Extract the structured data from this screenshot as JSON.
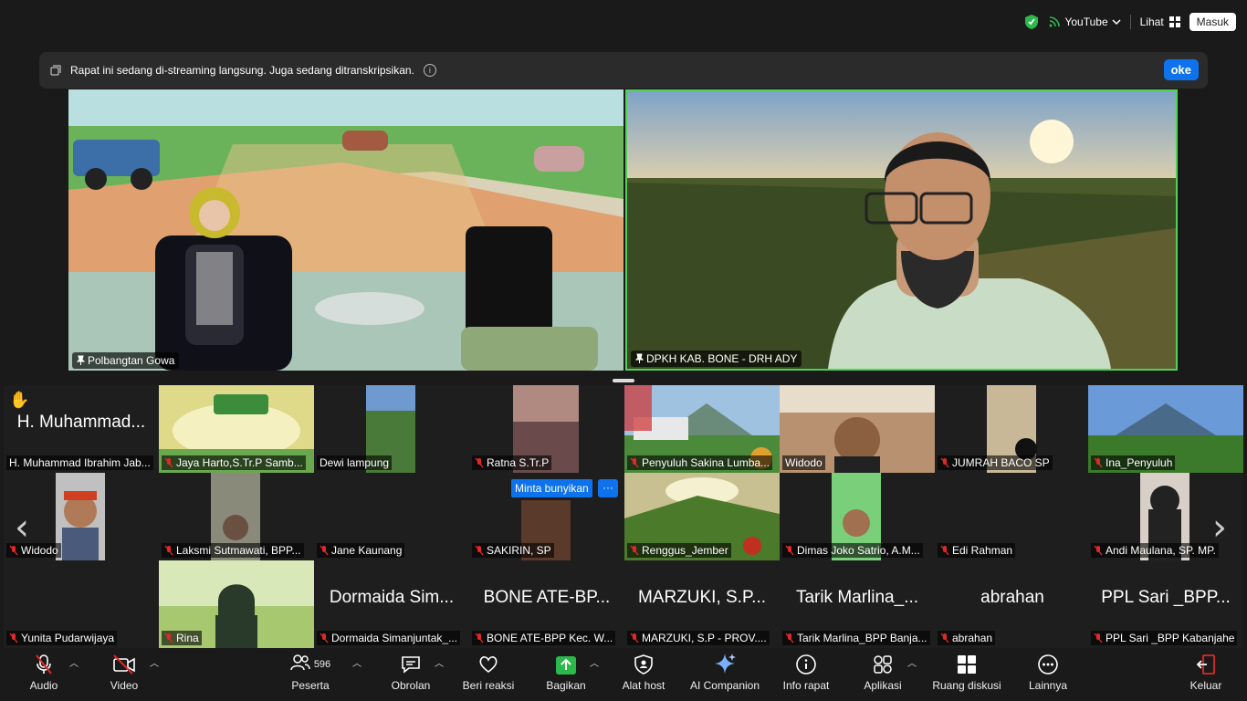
{
  "topbar": {
    "youtube": "YouTube",
    "lihat": "Lihat",
    "masuk": "Masuk"
  },
  "banner": {
    "text": "Rapat ini sedang di-streaming langsung. Juga sedang ditranskripsikan.",
    "ok": "oke"
  },
  "videos": [
    {
      "name": "Polbangtan Gowa"
    },
    {
      "name": "DPKH KAB. BONE - DRH ADY"
    }
  ],
  "gallery": [
    {
      "name": "H. Muhammad Ibrahim Jab...",
      "big": "H. Muhammad...",
      "muted": false
    },
    {
      "name": "Jaya Harto,S.Tr.P Samb...",
      "muted": true
    },
    {
      "name": "Dewi lampung",
      "muted": false
    },
    {
      "name": "Ratna S.Tr.P",
      "muted": true
    },
    {
      "name": "Penyuluh Sakina Lumba...",
      "muted": true
    },
    {
      "name": "Widodo",
      "muted": false
    },
    {
      "name": "JUMRAH BACO SP",
      "muted": true
    },
    {
      "name": "Ina_Penyuluh",
      "muted": true
    },
    {
      "name": "Widodo",
      "muted": true
    },
    {
      "name": "Laksmi Sutmawati, BPP...",
      "muted": true
    },
    {
      "name": "Jane Kaunang",
      "muted": true
    },
    {
      "name": "SAKIRIN, SP",
      "muted": true
    },
    {
      "name": "Renggus_Jember",
      "muted": true
    },
    {
      "name": "Dimas Joko  Satrio, A.M...",
      "muted": true
    },
    {
      "name": "Edi Rahman",
      "muted": true
    },
    {
      "name": "Andi Maulana, SP. MP.",
      "muted": true
    },
    {
      "name": "Yunita Pudarwijaya",
      "muted": true
    },
    {
      "name": "Rina",
      "muted": true
    },
    {
      "name": "Dormaida Simanjuntak_...",
      "big": "Dormaida Sim...",
      "muted": true
    },
    {
      "name": "BONE ATE-BPP Kec. W...",
      "big": "BONE ATE-BP...",
      "muted": true
    },
    {
      "name": "MARZUKI, S.P - PROV....",
      "big": "MARZUKI, S.P...",
      "muted": true
    },
    {
      "name": "Tarik Marlina_BPP Banja...",
      "big": "Tarik Marlina_...",
      "muted": true
    },
    {
      "name": "abrahan",
      "big": "abrahan",
      "muted": true
    },
    {
      "name": "PPL Sari _BPP Kabanjahe",
      "big": "PPL Sari _BPP...",
      "muted": true
    }
  ],
  "unmute_pill": "Minta bunyikan",
  "toolbar": {
    "audio": "Audio",
    "video": "Video",
    "participants": "Peserta",
    "participants_count": "596",
    "chat": "Obrolan",
    "react": "Beri reaksi",
    "share": "Bagikan",
    "host": "Alat host",
    "companion": "AI Companion",
    "info": "Info rapat",
    "apps": "Aplikasi",
    "rooms": "Ruang diskusi",
    "more": "Lainnya",
    "leave": "Keluar"
  }
}
